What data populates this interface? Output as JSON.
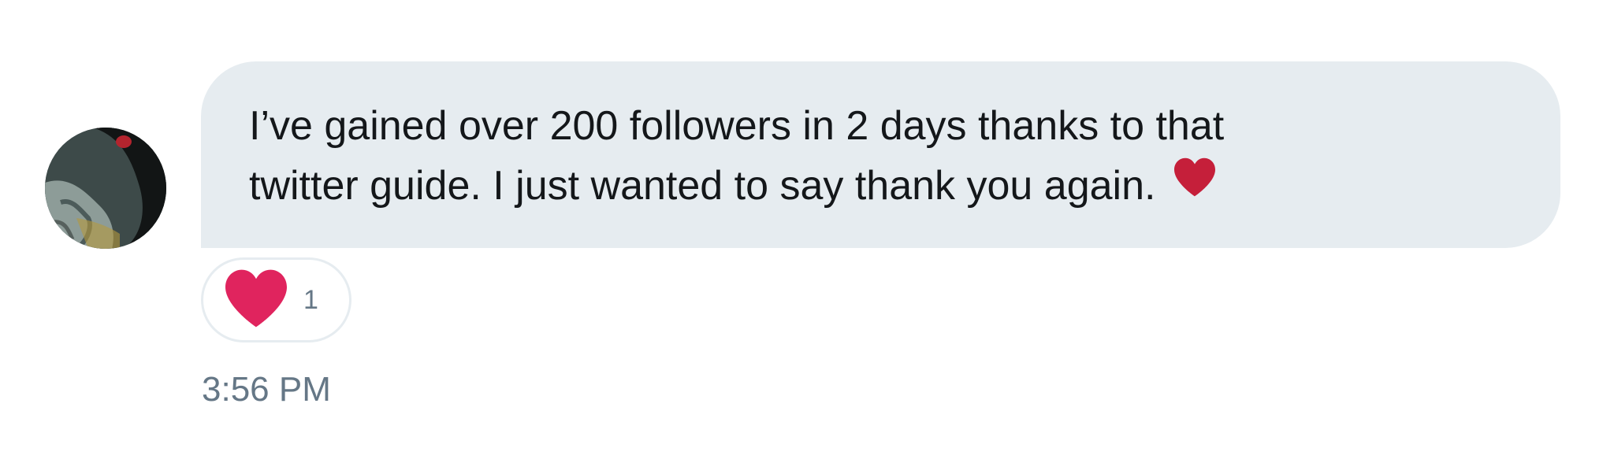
{
  "message": {
    "lines": [
      "I’ve gained over 200 followers in 2 days thanks to that",
      "twitter guide. I just wanted to say thank you again."
    ],
    "inline_emoji": "heart-icon"
  },
  "reaction": {
    "icon": "heart-icon",
    "count": "1"
  },
  "timestamp": "3:56 PM",
  "colors": {
    "bubble_bg": "#e6ecf0",
    "text": "#14171a",
    "muted": "#657786",
    "heart_inline": "#c51f3a",
    "heart_reaction": "#e0245e"
  }
}
